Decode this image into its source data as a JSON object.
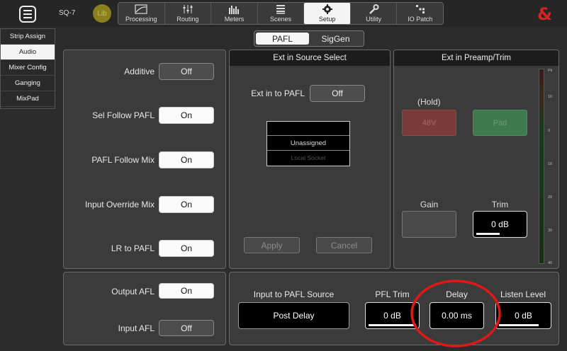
{
  "header": {
    "model": "SQ-7",
    "library_label": "Lib",
    "tabs": [
      {
        "label": "Processing",
        "icon": "processing-icon"
      },
      {
        "label": "Routing",
        "icon": "routing-icon"
      },
      {
        "label": "Meters",
        "icon": "meters-icon"
      },
      {
        "label": "Scenes",
        "icon": "scenes-icon"
      },
      {
        "label": "Setup",
        "icon": "gear-icon",
        "active": true
      },
      {
        "label": "Utility",
        "icon": "wrench-icon"
      },
      {
        "label": "IO Patch",
        "icon": "io-patch-icon"
      }
    ],
    "logo": "&"
  },
  "sidebar": {
    "items": [
      {
        "label": "Strip Assign"
      },
      {
        "label": "Audio",
        "active": true
      },
      {
        "label": "Mixer Config"
      },
      {
        "label": "Ganging"
      },
      {
        "label": "MixPad"
      }
    ]
  },
  "mode_tabs": {
    "pafl": "PAFL",
    "siggen": "SigGen",
    "active": "PAFL"
  },
  "pafl_settings": {
    "additive": {
      "label": "Additive",
      "value": "Off"
    },
    "sel_follow_pafl": {
      "label": "Sel Follow PAFL",
      "value": "On"
    },
    "pafl_follow_mix": {
      "label": "PAFL Follow Mix",
      "value": "On"
    },
    "input_override_mix": {
      "label": "Input Override Mix",
      "value": "On"
    },
    "lr_to_pafl": {
      "label": "LR to PAFL",
      "value": "On"
    }
  },
  "afl_settings": {
    "output_afl": {
      "label": "Output AFL",
      "value": "On"
    },
    "input_afl": {
      "label": "Input AFL",
      "value": "Off"
    }
  },
  "ext_source": {
    "title": "Ext in Source Select",
    "ext_in_label": "Ext in to PAFL",
    "ext_in_value": "Off",
    "list": [
      "",
      "Unassigned",
      "Local Socket"
    ],
    "apply": "Apply",
    "cancel": "Cancel"
  },
  "preamp": {
    "title": "Ext in Preamp/Trim",
    "hold": "(Hold)",
    "phantom": "48V",
    "pad": "Pad",
    "gain_label": "Gain",
    "trim_label": "Trim",
    "trim_value": "0 dB",
    "meter_ticks": [
      "Pk",
      "10",
      "0",
      "10",
      "20",
      "30",
      "40"
    ]
  },
  "bottom": {
    "source_label": "Input to PAFL Source",
    "source_value": "Post Delay",
    "pfl_trim_label": "PFL Trim",
    "pfl_trim_value": "0 dB",
    "delay_label": "Delay",
    "delay_value": "0.00 ms",
    "listen_label": "Listen Level",
    "listen_value": "0 dB"
  },
  "colors": {
    "accent_red": "#d42424",
    "phantom_red": "#8a3a3a",
    "pad_green": "#3f7d4c",
    "annotation_circle": "#e01818"
  }
}
